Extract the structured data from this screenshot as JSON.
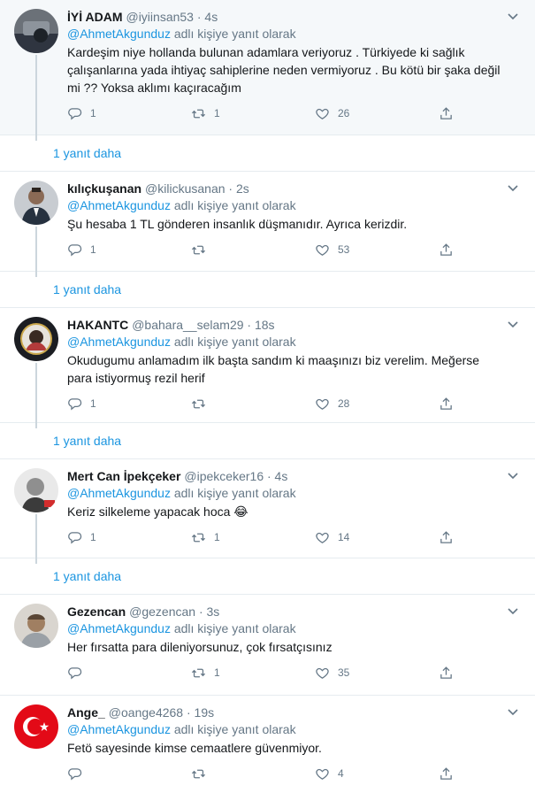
{
  "replying_suffix": "adlı kişiye yanıt olarak",
  "more_label": "1 yanıt daha",
  "colors": {
    "link": "#1b95e0",
    "muted": "#657786",
    "text": "#14171a",
    "highlight_bg": "#f5f8fa"
  },
  "tweets": [
    {
      "name": "İYİ ADAM",
      "handle": "@iyiinsan53",
      "time": "· 4s",
      "mention": "@AhmetAkgunduz",
      "text": "Kardeşim niye hollanda bulunan adamlara veriyoruz . Türkiyede ki sağlık çalışanlarına yada ihtiyaç sahiplerine neden vermiyoruz . Bu kötü bir şaka değil mi ?? Yoksa aklımı kaçıracağım",
      "replies": "1",
      "retweets": "1",
      "likes": "26"
    },
    {
      "name": "kılıçkuşanan",
      "handle": "@kilickusanan",
      "time": "· 2s",
      "mention": "@AhmetAkgunduz",
      "text": "Şu hesaba 1 TL gönderen insanlık düşmanıdır. Ayrıca kerizdir.",
      "replies": "1",
      "retweets": "",
      "likes": "53"
    },
    {
      "name": "HAKANTC",
      "handle": "@bahara__selam29",
      "time": "· 18s",
      "mention": "@AhmetAkgunduz",
      "text": "Okudugumu anlamadım ilk başta sandım ki maaşınızı biz verelim. Meğerse para istiyormuş rezil herif",
      "replies": "1",
      "retweets": "",
      "likes": "28"
    },
    {
      "name": "Mert Can İpekçeker",
      "handle": "@ipekceker16",
      "time": "· 4s",
      "mention": "@AhmetAkgunduz",
      "text": "Keriz silkeleme yapacak hoca 😂",
      "replies": "1",
      "retweets": "1",
      "likes": "14"
    },
    {
      "name": "Gezencan",
      "handle": "@gezencan",
      "time": "· 3s",
      "mention": "@AhmetAkgunduz",
      "text": "Her fırsatta para dileniyorsunuz, çok fırsatçısınız",
      "replies": "",
      "retweets": "1",
      "likes": "35"
    },
    {
      "name": "Ange_",
      "handle": "@oange4268",
      "time": "· 19s",
      "mention": "@AhmetAkgunduz",
      "text": "Fetö sayesinde kimse cemaatlere güvenmiyor.",
      "replies": "",
      "retweets": "",
      "likes": "4"
    }
  ]
}
